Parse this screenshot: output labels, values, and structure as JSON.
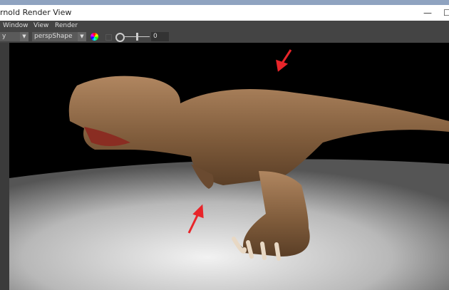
{
  "window": {
    "title": "rnold Render View",
    "minimize": "—",
    "maximize": "☐"
  },
  "menu": [
    "Window",
    "View",
    "Render"
  ],
  "toolbar": {
    "left_select": "y",
    "camera_select": "perspShape",
    "exposure_value": "0"
  },
  "colors": {
    "arrow": "#e8252a",
    "floor": "#c8c8c8",
    "background": "#000000"
  }
}
